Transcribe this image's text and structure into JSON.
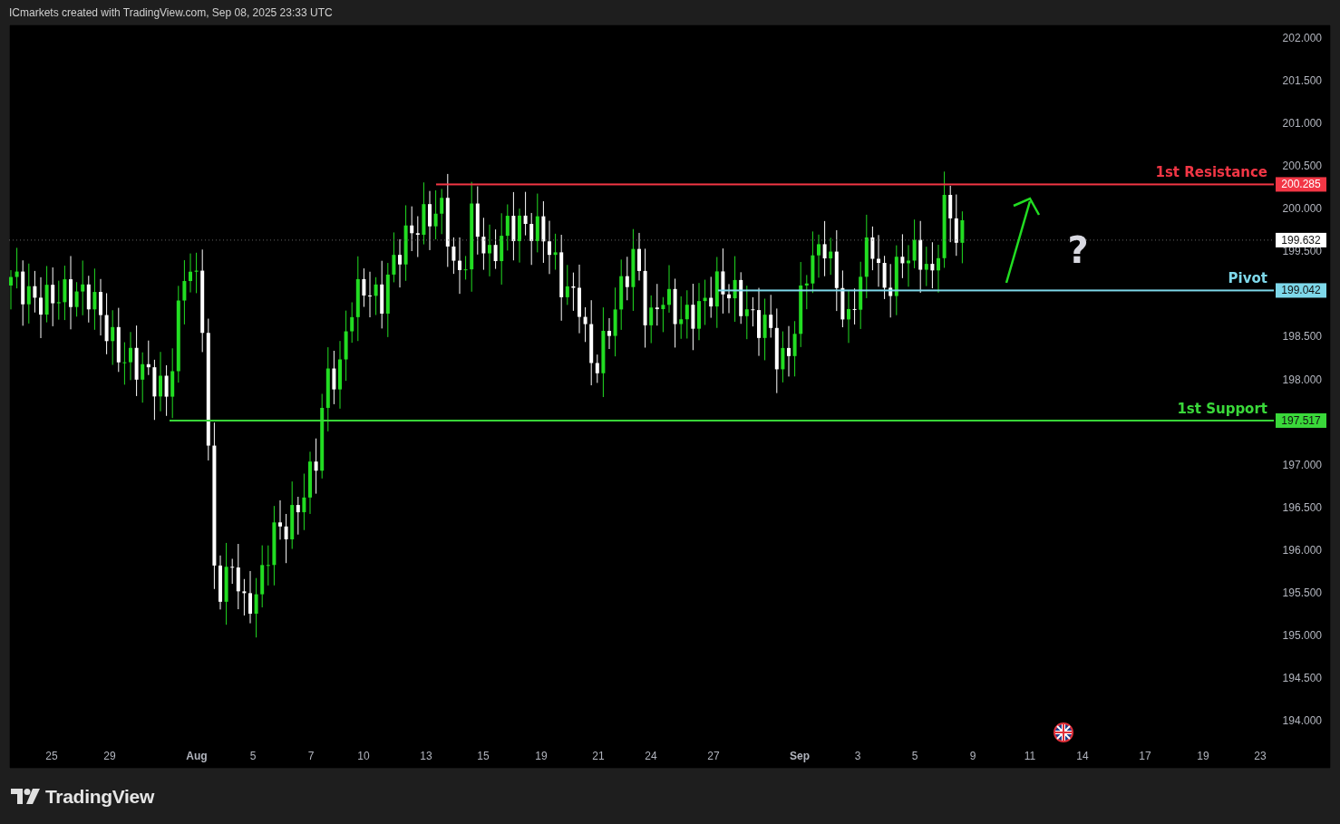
{
  "header": {
    "text": "ICmarkets created with TradingView.com, Sep 08, 2025 23:33 UTC"
  },
  "chart": {
    "price_ticks": [
      "202.000",
      "201.500",
      "201.000",
      "200.500",
      "200.000",
      "199.500",
      "198.500",
      "198.000",
      "197.000",
      "196.500",
      "196.000",
      "195.500",
      "195.000",
      "194.500",
      "194.000"
    ],
    "time_ticks": [
      {
        "label": "25",
        "kind": "day"
      },
      {
        "label": "29",
        "kind": "day"
      },
      {
        "label": "Aug",
        "kind": "month"
      },
      {
        "label": "5",
        "kind": "day"
      },
      {
        "label": "7",
        "kind": "day"
      },
      {
        "label": "10",
        "kind": "day"
      },
      {
        "label": "13",
        "kind": "day"
      },
      {
        "label": "15",
        "kind": "day"
      },
      {
        "label": "19",
        "kind": "day"
      },
      {
        "label": "21",
        "kind": "day"
      },
      {
        "label": "24",
        "kind": "day"
      },
      {
        "label": "27",
        "kind": "day"
      },
      {
        "label": "Sep",
        "kind": "month"
      },
      {
        "label": "3",
        "kind": "day"
      },
      {
        "label": "5",
        "kind": "day"
      },
      {
        "label": "9",
        "kind": "day"
      },
      {
        "label": "11",
        "kind": "day"
      },
      {
        "label": "14",
        "kind": "day"
      },
      {
        "label": "17",
        "kind": "day"
      },
      {
        "label": "19",
        "kind": "day"
      },
      {
        "label": "23",
        "kind": "day"
      }
    ],
    "levels": [
      {
        "kind": "resistance",
        "name": "1st Resistance",
        "price": "200.285",
        "color": "#f23645"
      },
      {
        "kind": "pivot",
        "name": "Pivot",
        "price": "199.042",
        "color": "#7ed8ea"
      },
      {
        "kind": "support",
        "name": "1st Support",
        "price": "197.517",
        "color": "#3ad83a"
      }
    ],
    "last_price": "199.632",
    "annotation": "?"
  },
  "footer": {
    "logo": "TradingView"
  }
}
